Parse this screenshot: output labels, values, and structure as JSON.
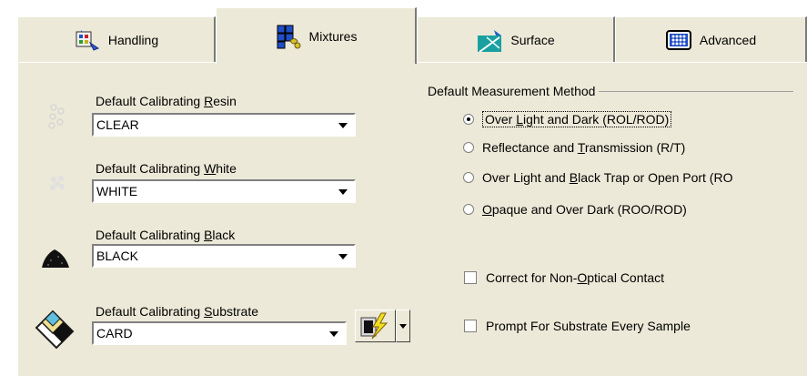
{
  "tabs": [
    {
      "label": "Handling",
      "icon": "handling-icon"
    },
    {
      "label": "Mixtures",
      "icon": "mixtures-icon"
    },
    {
      "label": "Surface",
      "icon": "surface-icon"
    },
    {
      "label": "Advanced",
      "icon": "advanced-icon"
    }
  ],
  "active_tab": "Mixtures",
  "fields": {
    "resin": {
      "label_pre": "Default Calibrating ",
      "label_u": "R",
      "label_post": "esin",
      "value": "CLEAR"
    },
    "white": {
      "label_pre": "Default Calibrating ",
      "label_u": "W",
      "label_post": "hite",
      "value": "WHITE"
    },
    "black": {
      "label_pre": "Default Calibrating ",
      "label_u": "B",
      "label_post": "lack",
      "value": "BLACK"
    },
    "substrate": {
      "label_pre": "Default Calibrating ",
      "label_u": "S",
      "label_post": "ubstrate",
      "value": "CARD"
    }
  },
  "measurement": {
    "title": "Default Measurement Method",
    "options": [
      {
        "pre": "Over ",
        "u": "L",
        "post": "ight and Dark (ROL/ROD)",
        "checked": true
      },
      {
        "pre": "Reflectance and ",
        "u": "T",
        "post": "ransmission (R/T)",
        "checked": false
      },
      {
        "pre": "Over Light and ",
        "u": "B",
        "post": "lack Trap or Open Port (RO",
        "checked": false
      },
      {
        "pre": "",
        "u": "O",
        "post": "paque and Over Dark (ROO/ROD)",
        "checked": false
      }
    ]
  },
  "checks": {
    "nonoptical": {
      "pre": "Correct for Non-",
      "u": "O",
      "post": "ptical Contact",
      "checked": false
    },
    "prompt": {
      "pre": "Prompt For Substrate Every Sample",
      "u": "",
      "post": "",
      "checked": false
    }
  },
  "colors": {
    "panel_bg": "#ece9d8",
    "radio_border": "#808080"
  }
}
